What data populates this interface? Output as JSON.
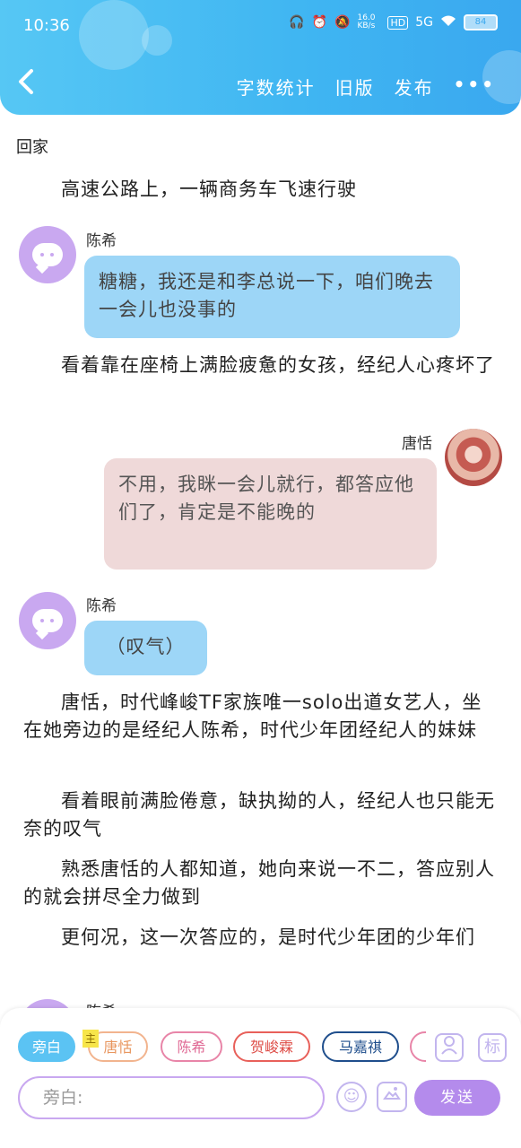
{
  "status": {
    "time": "10:36",
    "net_speed": "16.0 KB/s",
    "hd": "HD",
    "signal": "5G",
    "battery": "84"
  },
  "nav": {
    "word_count": "字数统计",
    "old_version": "旧版",
    "publish": "发布",
    "more": "•••"
  },
  "content": {
    "chapter_title": "回家",
    "paragraphs": [
      "高速公路上，一辆商务车飞速行驶",
      "看着靠在座椅上满脸疲惫的女孩，经纪人心疼坏了",
      "唐恬，时代峰峻TF家族唯一solo出道女艺人，坐在她旁边的是经纪人陈希，时代少年团经纪人的妹妹",
      "看着眼前满脸倦意，缺执拗的人，经纪人也只能无奈的叹气",
      "熟悉唐恬的人都知道，她向来说一不二，答应别人的就会拼尽全力做到",
      "更何况，这一次答应的，是时代少年团的少年们"
    ],
    "messages": [
      {
        "speaker": "陈希",
        "text": "糖糖，我还是和李总说一下，咱们晚去一会儿也没事的"
      },
      {
        "speaker": "唐恬",
        "text": "不用，我眯一会儿就行，都答应他们了，肯定是不能晚的"
      },
      {
        "speaker": "陈希",
        "text": "（叹气）"
      }
    ],
    "partial_name": "陈希"
  },
  "composer": {
    "host_badge": "主",
    "chips": [
      "旁白",
      "唐恬",
      "陈希",
      "贺峻霖",
      "马嘉祺"
    ],
    "chip_colors": [
      "#5bc3f3",
      "#f2b48e",
      "#e885a8",
      "#e8605a",
      "#1f4e8c"
    ],
    "input_placeholder": "旁白:",
    "role_icon": "person-icon",
    "tag_icon": "标",
    "send": "发送"
  }
}
